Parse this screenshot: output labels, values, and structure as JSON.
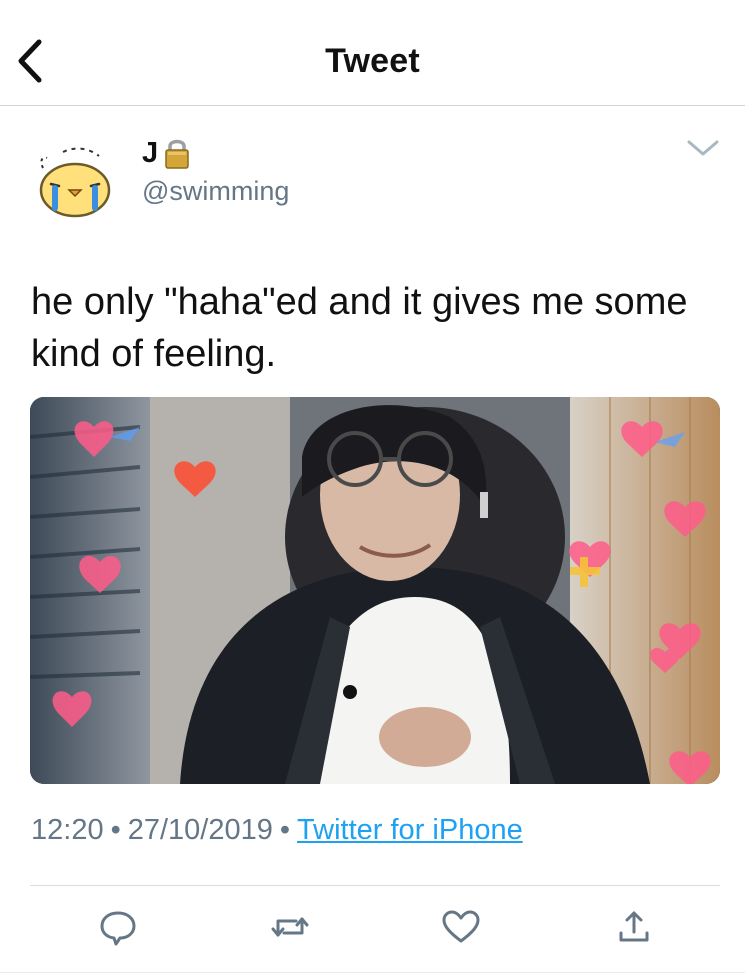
{
  "header": {
    "title": "Tweet",
    "back_icon": "chevron-left-icon"
  },
  "tweet": {
    "author": {
      "display_name": "J",
      "handle": "@swimming",
      "protected_icon": "lock-icon",
      "avatar": "crying-chick-avatar"
    },
    "text": "he only \"haha\"ed and it gives me some kind of feeling.",
    "media": {
      "description_icon": "photo-icon"
    },
    "time": "12:20",
    "date": "27/10/2019",
    "separator": "•",
    "source": "Twitter for iPhone"
  },
  "actions": {
    "reply_icon": "reply-icon",
    "retweet_icon": "retweet-icon",
    "like_icon": "heart-icon",
    "share_icon": "share-icon"
  },
  "colors": {
    "link": "#1da1f2",
    "muted": "#657786",
    "divider": "#cfd4d8"
  }
}
